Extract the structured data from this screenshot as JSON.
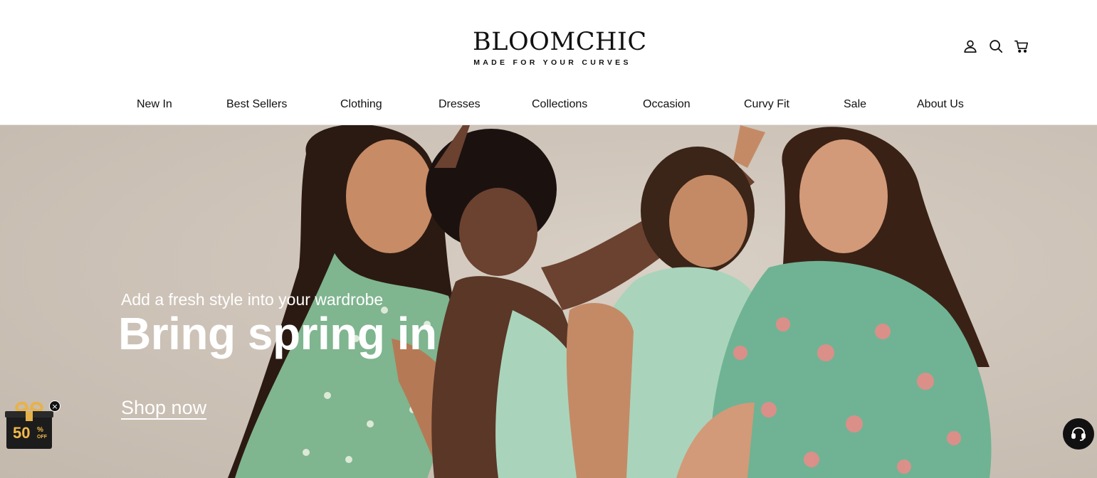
{
  "brand": {
    "name": "BLOOMCHIC",
    "tagline": "MADE FOR YOUR CURVES"
  },
  "header_icons": [
    "account-icon",
    "search-icon",
    "cart-icon"
  ],
  "nav": {
    "items": [
      {
        "label": "New In"
      },
      {
        "label": "Best Sellers"
      },
      {
        "label": "Clothing"
      },
      {
        "label": "Dresses"
      },
      {
        "label": "Collections"
      },
      {
        "label": "Occasion"
      },
      {
        "label": "Curvy Fit"
      },
      {
        "label": "Sale"
      },
      {
        "label": "About Us"
      }
    ]
  },
  "hero": {
    "subtitle": "Add a fresh style into your wardrobe",
    "title": "Bring spring in",
    "cta": "Shop now"
  },
  "gift_widget": {
    "value": "50",
    "percent": "%",
    "off": "OFF",
    "close": "×"
  },
  "colors": {
    "hero_background": "#cfc5ba",
    "gift_gold": "#f0b94c",
    "dress_green": "#7fb58f",
    "dress_mint": "#a9d4bb"
  }
}
